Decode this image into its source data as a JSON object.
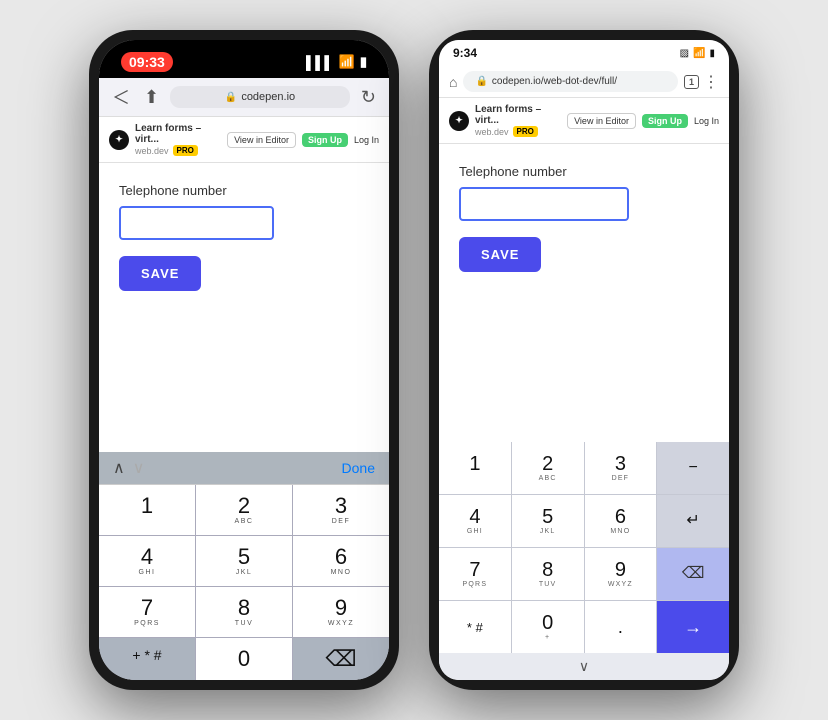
{
  "left_phone": {
    "status_time": "09:33",
    "battery_icon": "🔋",
    "url": "codepen.io",
    "safari_reload": "↻",
    "cp_logo": "✦",
    "cp_title": "Learn forms – virt...",
    "cp_domain": "web.dev",
    "cp_pro": "PRO",
    "cp_view_in_editor": "View in Editor",
    "cp_signup": "Sign Up",
    "cp_login": "Log In",
    "label": "Telephone number",
    "save_label": "SAVE",
    "keyboard_done": "Done",
    "keys": [
      {
        "main": "1",
        "sub": ""
      },
      {
        "main": "2",
        "sub": "ABC"
      },
      {
        "main": "3",
        "sub": "DEF"
      },
      {
        "main": "4",
        "sub": "GHI"
      },
      {
        "main": "5",
        "sub": "JKL"
      },
      {
        "main": "6",
        "sub": "MNO"
      },
      {
        "main": "7",
        "sub": "PQRS"
      },
      {
        "main": "8",
        "sub": "TUV"
      },
      {
        "main": "9",
        "sub": "WXYZ"
      },
      {
        "main": "+ * #",
        "sub": ""
      },
      {
        "main": "0",
        "sub": ""
      },
      {
        "main": "⌫",
        "sub": ""
      }
    ]
  },
  "right_phone": {
    "status_time": "9:34",
    "status_icons": "🔒 📶 🔋",
    "url": "codepen.io/web-dot-dev/full/",
    "cp_logo": "✦",
    "cp_title": "Learn forms – virt...",
    "cp_domain": "web.dev",
    "cp_pro": "PRO",
    "cp_view_in_editor": "View in Editor",
    "cp_signup": "Sign Up",
    "cp_login": "Log In",
    "label": "Telephone number",
    "save_label": "SAVE",
    "keys": [
      {
        "main": "1",
        "sub": "",
        "type": "light"
      },
      {
        "main": "2",
        "sub": "ABC",
        "type": "light"
      },
      {
        "main": "3",
        "sub": "DEF",
        "type": "light"
      },
      {
        "main": "−",
        "sub": "",
        "type": "dark"
      },
      {
        "main": "4",
        "sub": "GHI",
        "type": "light"
      },
      {
        "main": "5",
        "sub": "JKL",
        "type": "light"
      },
      {
        "main": "6",
        "sub": "MNO",
        "type": "light"
      },
      {
        "main": "↵",
        "sub": "",
        "type": "dark"
      },
      {
        "main": "7",
        "sub": "PQRS",
        "type": "light"
      },
      {
        "main": "8",
        "sub": "TUV",
        "type": "light"
      },
      {
        "main": "9",
        "sub": "WXYZ",
        "type": "light"
      },
      {
        "main": "⌫",
        "sub": "",
        "type": "accent"
      },
      {
        "main": "* #",
        "sub": "",
        "type": "light"
      },
      {
        "main": "0",
        "sub": "+",
        "type": "light"
      },
      {
        "main": ".",
        "sub": "",
        "type": "light"
      },
      {
        "main": "→",
        "sub": "",
        "type": "go"
      }
    ],
    "chevron": "∨"
  }
}
